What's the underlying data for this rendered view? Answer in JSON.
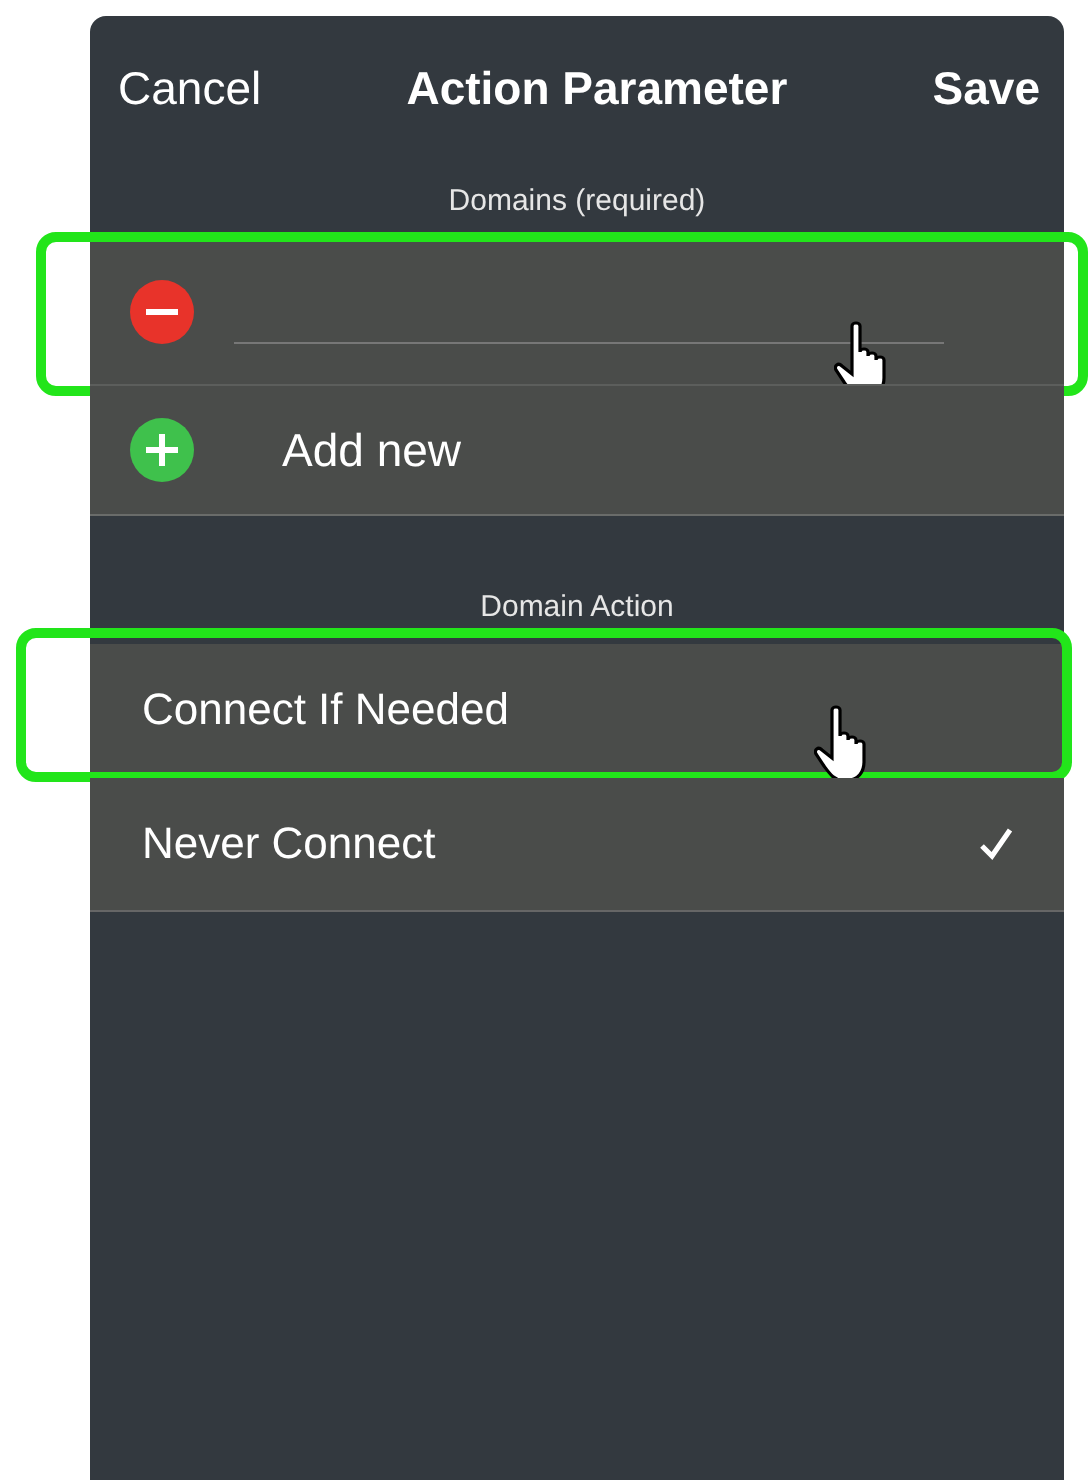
{
  "header": {
    "cancel": "Cancel",
    "title": "Action Parameter",
    "save": "Save"
  },
  "domains": {
    "header": "Domains (required)",
    "entries": [
      {
        "kind": "field",
        "highlighted": true
      }
    ],
    "add_label": "Add new"
  },
  "domain_action": {
    "header": "Domain Action",
    "options": [
      {
        "label": "Connect If Needed",
        "selected": false,
        "highlighted": true
      },
      {
        "label": "Never Connect",
        "selected": true,
        "highlighted": false
      }
    ]
  }
}
